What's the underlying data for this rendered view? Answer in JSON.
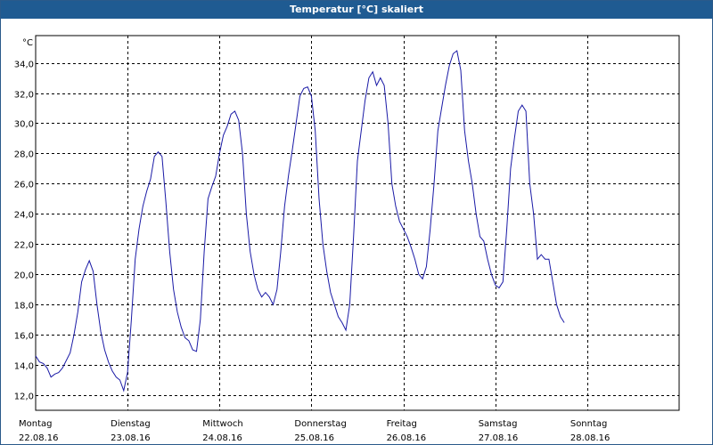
{
  "window": {
    "title": "Temperatur [°C] skaliert"
  },
  "colors": {
    "title_bar": "#1f5b92",
    "series": "#1a1aa6",
    "grid": "#000000"
  },
  "chart_data": {
    "type": "line",
    "title": "Temperatur [°C] skaliert",
    "ylabel": "°C",
    "ylim": [
      11.0,
      35.8
    ],
    "yticks": [
      12,
      14,
      16,
      18,
      20,
      22,
      24,
      26,
      28,
      30,
      32,
      34
    ],
    "ytick_labels": [
      "12,0",
      "14,0",
      "16,0",
      "18,0",
      "20,0",
      "22,0",
      "24,0",
      "26,0",
      "28,0",
      "30,0",
      "32,0",
      "34,0"
    ],
    "xlim": [
      0,
      168
    ],
    "x_unit": "hours since 22.08.16 00:00",
    "xticks": [
      0,
      24,
      48,
      72,
      96,
      120,
      144,
      168
    ],
    "xtick_labels": [
      {
        "day": "Montag",
        "date": "22.08.16"
      },
      {
        "day": "Dienstag",
        "date": "23.08.16"
      },
      {
        "day": "Mittwoch",
        "date": "24.08.16"
      },
      {
        "day": "Donnerstag",
        "date": "25.08.16"
      },
      {
        "day": "Freitag",
        "date": "26.08.16"
      },
      {
        "day": "Samstag",
        "date": "27.08.16"
      },
      {
        "day": "Sonntag",
        "date": "28.08.16"
      }
    ],
    "grid": true,
    "series": [
      {
        "points": [
          [
            0,
            14.6
          ],
          [
            1,
            14.2
          ],
          [
            2,
            14.1
          ],
          [
            3,
            13.8
          ],
          [
            4,
            13.2
          ],
          [
            5,
            13.4
          ],
          [
            6,
            13.5
          ],
          [
            7,
            13.8
          ],
          [
            8,
            14.3
          ],
          [
            9,
            14.8
          ],
          [
            10,
            16.0
          ],
          [
            11,
            17.5
          ],
          [
            12,
            19.5
          ],
          [
            13,
            20.3
          ],
          [
            14,
            20.9
          ],
          [
            15,
            20.2
          ],
          [
            16,
            18.0
          ],
          [
            17,
            16.2
          ],
          [
            18,
            15.0
          ],
          [
            19,
            14.2
          ],
          [
            20,
            13.6
          ],
          [
            21,
            13.2
          ],
          [
            22,
            13.0
          ],
          [
            23,
            12.3
          ],
          [
            24,
            13.5
          ],
          [
            25,
            17.0
          ],
          [
            26,
            21.0
          ],
          [
            27,
            23.0
          ],
          [
            28,
            24.5
          ],
          [
            29,
            25.5
          ],
          [
            30,
            26.3
          ],
          [
            31,
            27.8
          ],
          [
            32,
            28.1
          ],
          [
            33,
            27.8
          ],
          [
            34,
            24.8
          ],
          [
            35,
            21.5
          ],
          [
            36,
            19.0
          ],
          [
            37,
            17.5
          ],
          [
            38,
            16.5
          ],
          [
            39,
            15.8
          ],
          [
            40,
            15.6
          ],
          [
            41,
            15.0
          ],
          [
            42,
            14.9
          ],
          [
            43,
            17.0
          ],
          [
            44,
            21.5
          ],
          [
            45,
            25.0
          ],
          [
            46,
            25.8
          ],
          [
            47,
            26.5
          ],
          [
            48,
            28.0
          ],
          [
            49,
            29.2
          ],
          [
            50,
            29.8
          ],
          [
            51,
            30.6
          ],
          [
            52,
            30.8
          ],
          [
            53,
            30.2
          ],
          [
            54,
            28.0
          ],
          [
            55,
            24.0
          ],
          [
            56,
            21.5
          ],
          [
            57,
            20.0
          ],
          [
            58,
            19.0
          ],
          [
            59,
            18.5
          ],
          [
            60,
            18.8
          ],
          [
            61,
            18.5
          ],
          [
            62,
            18.0
          ],
          [
            63,
            19.0
          ],
          [
            64,
            21.5
          ],
          [
            65,
            24.5
          ],
          [
            66,
            26.5
          ],
          [
            67,
            28.2
          ],
          [
            68,
            30.0
          ],
          [
            69,
            31.8
          ],
          [
            70,
            32.3
          ],
          [
            71,
            32.4
          ],
          [
            72,
            31.8
          ],
          [
            73,
            29.5
          ],
          [
            74,
            25.0
          ],
          [
            75,
            22.0
          ],
          [
            76,
            20.2
          ],
          [
            77,
            18.8
          ],
          [
            78,
            18.0
          ],
          [
            79,
            17.2
          ],
          [
            80,
            16.8
          ],
          [
            81,
            16.3
          ],
          [
            82,
            18.0
          ],
          [
            83,
            22.5
          ],
          [
            84,
            27.5
          ],
          [
            85,
            29.5
          ],
          [
            86,
            31.5
          ],
          [
            87,
            33.0
          ],
          [
            88,
            33.4
          ],
          [
            89,
            32.5
          ],
          [
            90,
            33.0
          ],
          [
            91,
            32.5
          ],
          [
            92,
            30.0
          ],
          [
            93,
            26.0
          ],
          [
            94,
            24.5
          ],
          [
            95,
            23.5
          ],
          [
            96,
            23.0
          ],
          [
            97,
            22.5
          ],
          [
            98,
            21.8
          ],
          [
            99,
            21.0
          ],
          [
            100,
            20.0
          ],
          [
            101,
            19.7
          ],
          [
            102,
            20.5
          ],
          [
            103,
            23.0
          ],
          [
            104,
            26.0
          ],
          [
            105,
            29.5
          ],
          [
            106,
            31.0
          ],
          [
            107,
            32.5
          ],
          [
            108,
            33.8
          ],
          [
            109,
            34.6
          ],
          [
            110,
            34.8
          ],
          [
            111,
            33.5
          ],
          [
            112,
            29.5
          ],
          [
            113,
            27.5
          ],
          [
            114,
            26.0
          ],
          [
            115,
            24.0
          ],
          [
            116,
            22.5
          ],
          [
            117,
            22.2
          ],
          [
            118,
            21.0
          ],
          [
            119,
            20.0
          ],
          [
            120,
            19.3
          ],
          [
            121,
            19.1
          ],
          [
            122,
            19.5
          ],
          [
            123,
            23.0
          ],
          [
            124,
            27.0
          ],
          [
            125,
            29.0
          ],
          [
            126,
            30.8
          ],
          [
            127,
            31.2
          ],
          [
            128,
            30.8
          ],
          [
            129,
            26.0
          ],
          [
            130,
            24.0
          ],
          [
            131,
            21.0
          ],
          [
            132,
            21.3
          ],
          [
            133,
            21.0
          ],
          [
            134,
            21.0
          ],
          [
            135,
            19.5
          ],
          [
            136,
            18.0
          ],
          [
            137,
            17.2
          ],
          [
            138,
            16.8
          ]
        ]
      }
    ]
  }
}
